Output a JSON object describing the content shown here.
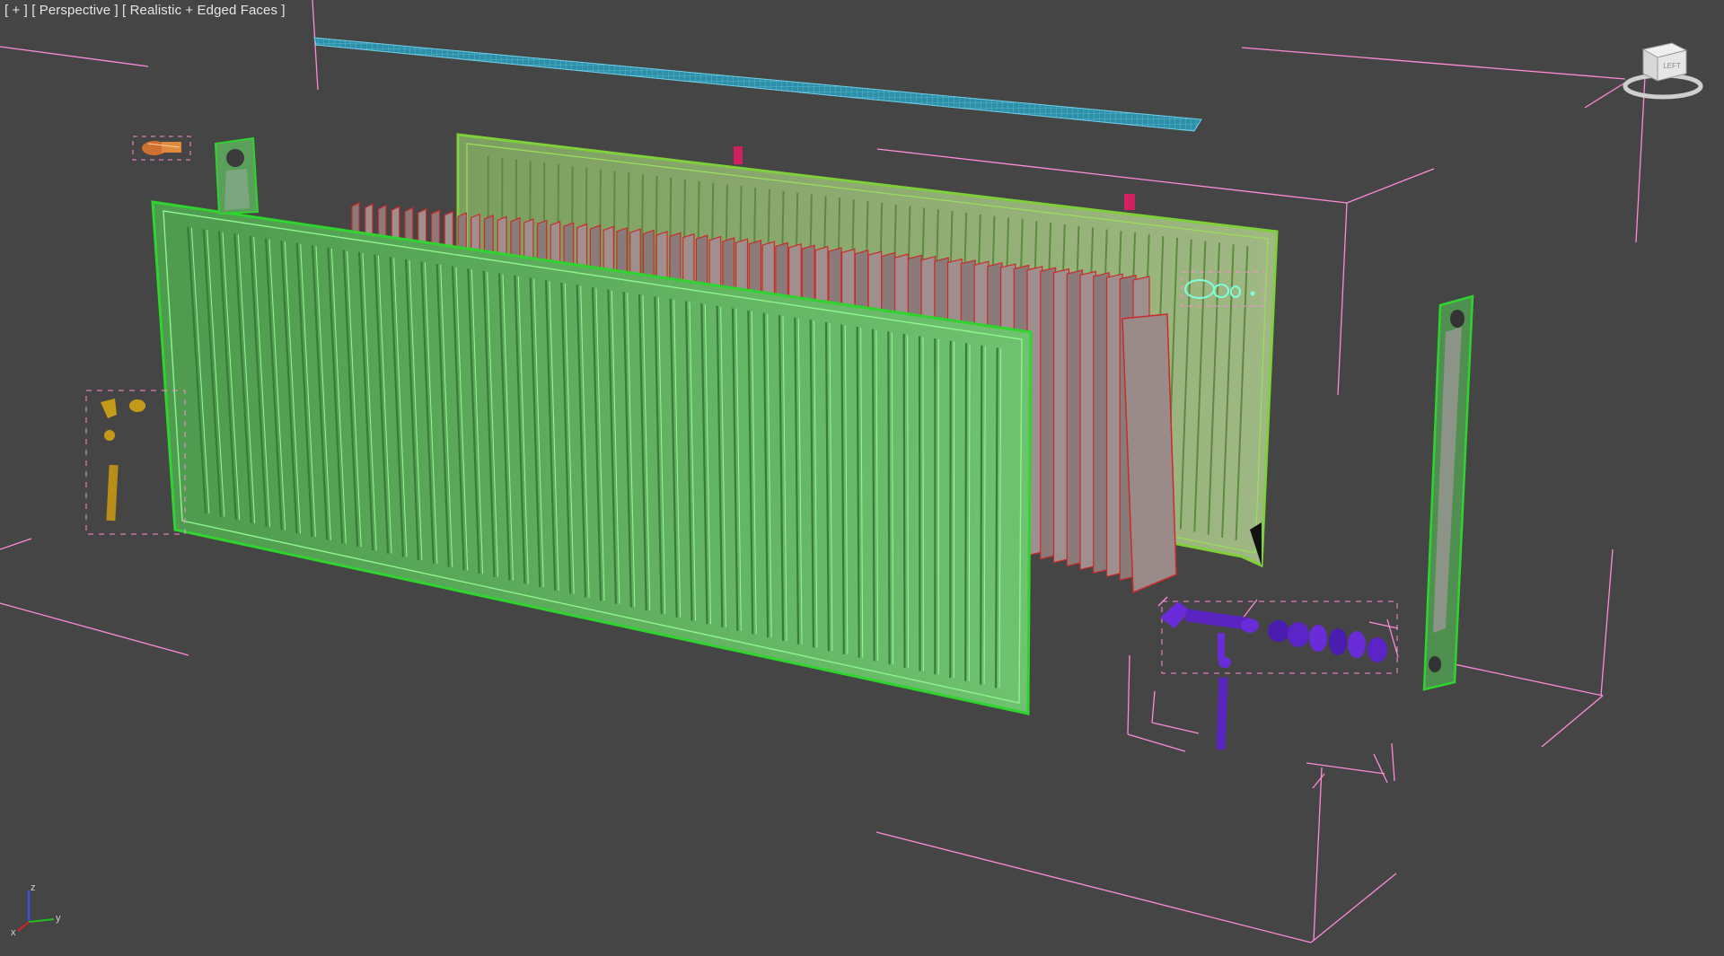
{
  "viewport": {
    "bracket_plus": "[ + ]",
    "bracket_view": "[ Perspective ]",
    "bracket_shading": "[ Realistic + Edged Faces ]"
  },
  "viewcube": {
    "face_label": "LEFT",
    "icon": "viewcube-icon"
  },
  "axis_tripod": {
    "x_label": "x",
    "y_label": "y",
    "z_label": "z",
    "icon": "axis-tripod-icon"
  },
  "colors": {
    "background": "#454545",
    "bbox_lines": "#ff8ad8",
    "front_panel": "#63b463",
    "front_panel_edges": "#2fd42f",
    "rear_panel": "#8aa866",
    "rear_panel_edges": "#7fd03a",
    "fins": "#9b8a8a",
    "fin_edges": "#cc2a2a",
    "top_grille": "#2e8fa8",
    "valve_parts": "#6a2cd8",
    "brackets": "#c59a1a",
    "side_cap": "#5aa05a",
    "small_part": "#d07030",
    "cyan_part": "#7fffe0"
  },
  "scene_objects": [
    "top-grille",
    "rear-panel",
    "heating-fins",
    "front-panel",
    "side-cap-left",
    "side-cap-right",
    "valve-assembly",
    "mounting-brackets",
    "bleed-plug",
    "air-vent"
  ]
}
